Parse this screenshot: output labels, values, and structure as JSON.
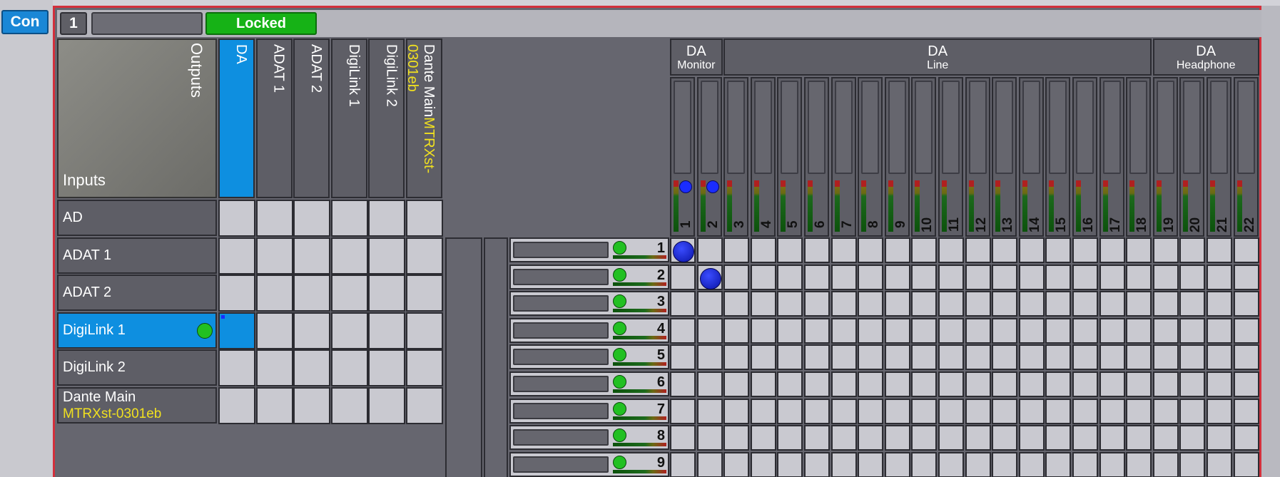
{
  "app": {
    "con_label": "Con"
  },
  "toolbar": {
    "device_number": "1",
    "lock_status": "Locked"
  },
  "router": {
    "outputs_label": "Outputs",
    "inputs_label": "Inputs",
    "outputs": [
      {
        "name": "DA",
        "sub": "",
        "selected": true
      },
      {
        "name": "ADAT 1",
        "sub": "",
        "selected": false
      },
      {
        "name": "ADAT 2",
        "sub": "",
        "selected": false
      },
      {
        "name": "DigiLink 1",
        "sub": "",
        "selected": false
      },
      {
        "name": "DigiLink 2",
        "sub": "",
        "selected": false
      },
      {
        "name": "Dante Main",
        "sub": "MTRXst-0301eb",
        "selected": false
      }
    ],
    "inputs": [
      {
        "name": "AD",
        "sub": "",
        "selected": false,
        "status": false
      },
      {
        "name": "ADAT 1",
        "sub": "",
        "selected": false,
        "status": false
      },
      {
        "name": "ADAT 2",
        "sub": "",
        "selected": false,
        "status": false
      },
      {
        "name": "DigiLink 1",
        "sub": "",
        "selected": true,
        "status": true
      },
      {
        "name": "DigiLink 2",
        "sub": "",
        "selected": false,
        "status": false
      },
      {
        "name": "Dante Main",
        "sub": "MTRXst-0301eb",
        "selected": false,
        "status": false
      }
    ],
    "active_cell": {
      "row": 3,
      "col": 0
    }
  },
  "outputs_panel": {
    "groups": [
      {
        "name": "DA",
        "sub": "Monitor",
        "channels": 2
      },
      {
        "name": "DA",
        "sub": "Line",
        "channels": 16
      },
      {
        "name": "DA",
        "sub": "Headphone",
        "channels": 4
      }
    ],
    "channels": [
      "1",
      "2",
      "3",
      "4",
      "5",
      "6",
      "7",
      "8",
      "9",
      "10",
      "11",
      "12",
      "13",
      "14",
      "15",
      "16",
      "17",
      "18",
      "19",
      "20",
      "21",
      "22"
    ],
    "channel_markers": [
      0,
      1
    ]
  },
  "sources": [
    "1",
    "2",
    "3",
    "4",
    "5",
    "6",
    "7",
    "8",
    "9"
  ],
  "routes": [
    {
      "source": "1",
      "channel": "1"
    },
    {
      "source": "2",
      "channel": "2"
    }
  ],
  "colors": {
    "accent": "#0e8fe0",
    "locked": "#16b216",
    "frame_border": "#d3303c",
    "route_dot": "#1a2cff",
    "signal_led": "#22c022",
    "secondary_text": "#f0e020"
  }
}
